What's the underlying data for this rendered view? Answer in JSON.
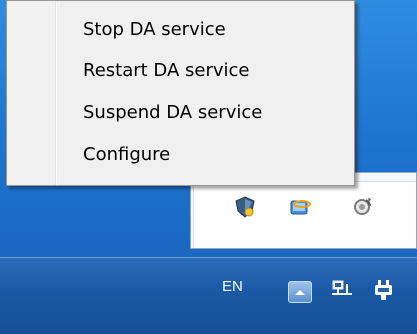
{
  "context_menu": {
    "items": [
      {
        "label": "Stop DA service"
      },
      {
        "label": "Restart DA service"
      },
      {
        "label": "Suspend DA service"
      },
      {
        "label": "Configure"
      }
    ]
  },
  "tray_popup": {
    "icons": [
      "security-shield-icon",
      "network-globe-icon",
      "sync-gear-icon"
    ]
  },
  "taskbar": {
    "language": "EN",
    "icons": [
      "show-hidden-icons-button",
      "network-icon",
      "power-icon"
    ]
  },
  "colors": {
    "taskbar": "#1b5aa6",
    "desktop": "#1e74cf",
    "menu_background": "#f0f0f0"
  }
}
